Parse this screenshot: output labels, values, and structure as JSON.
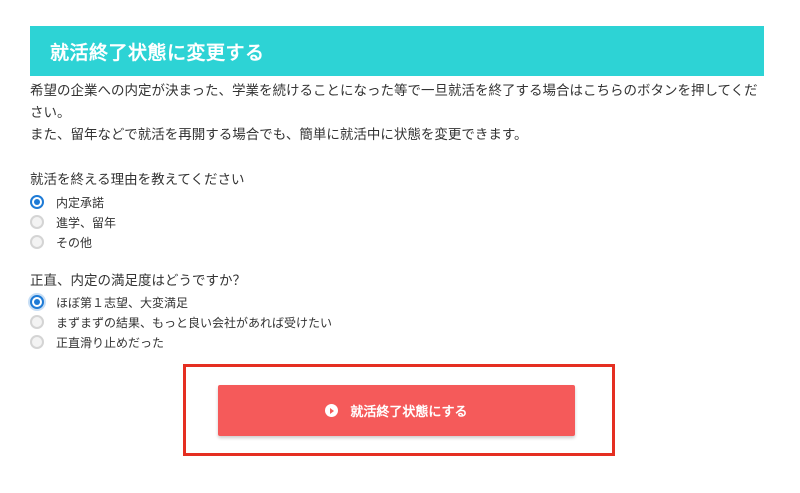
{
  "section": {
    "title": "就活終了状態に変更する"
  },
  "intro": {
    "line1": "希望の企業への内定が決まった、学業を続けることになった等で一旦就活を終了する場合はこちらのボタンを押してくだ",
    "line2": "さい。",
    "line3": "また、留年などで就活を再開する場合でも、簡単に就活中に状態を変更できます。"
  },
  "questions": [
    {
      "label": "就活を終える理由を教えてください",
      "options": [
        {
          "label": "内定承諾",
          "selected": true
        },
        {
          "label": "進学、留年",
          "selected": false
        },
        {
          "label": "その他",
          "selected": false
        }
      ]
    },
    {
      "label": "正直、内定の満足度はどうですか？",
      "options": [
        {
          "label": "ほぼ第１志望、大変満足",
          "selected": true
        },
        {
          "label": "まずまずの結果、もっと良い会社があれば受けたい",
          "selected": false
        },
        {
          "label": "正直滑り止めだった",
          "selected": false
        }
      ]
    }
  ],
  "submit": {
    "label": "就活終了状態にする",
    "icon": "play-circle-icon"
  },
  "colors": {
    "header_bg": "#2dd3d5",
    "button_bg": "#f55a5a",
    "highlight_border": "#e52f21",
    "radio_selected": "#1e7bd6"
  }
}
